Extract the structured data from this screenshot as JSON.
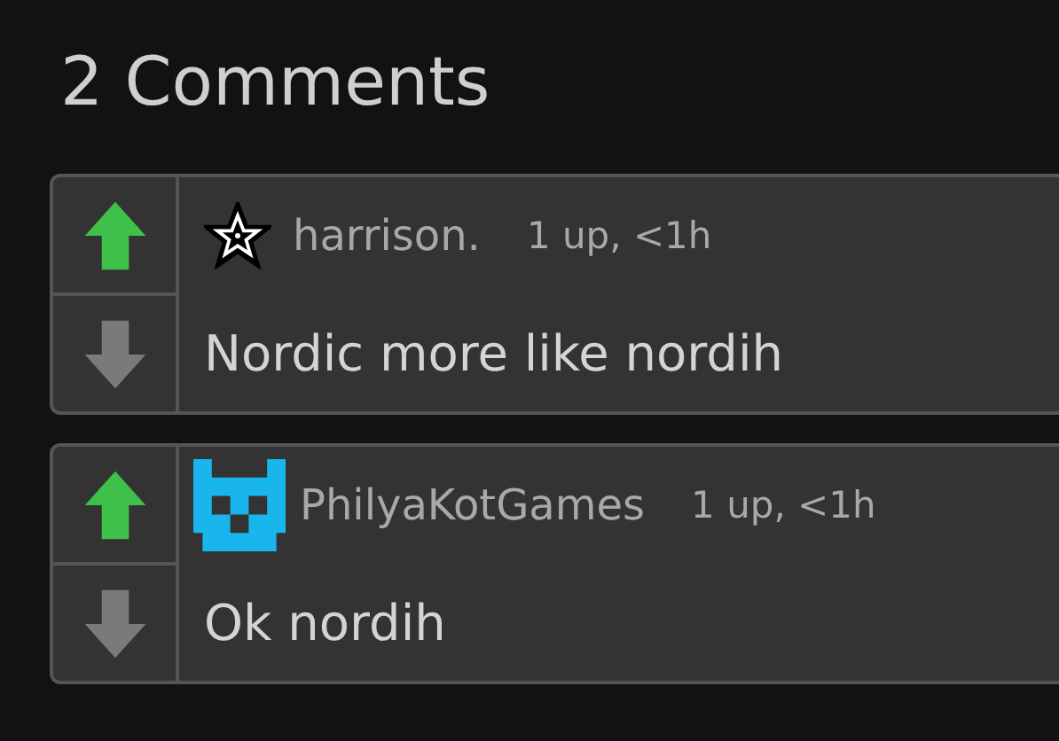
{
  "heading": "2 Comments",
  "comments": [
    {
      "avatar": {
        "kind": "star"
      },
      "username": "harrison.",
      "meta": "1 up, <1h",
      "text": "Nordic more like nordih",
      "upvoted": true,
      "downvoted": false
    },
    {
      "avatar": {
        "kind": "pixel"
      },
      "username": "PhilyaKotGames",
      "meta": "1 up, <1h",
      "text": "Ok nordih",
      "upvoted": true,
      "downvoted": false
    }
  ]
}
